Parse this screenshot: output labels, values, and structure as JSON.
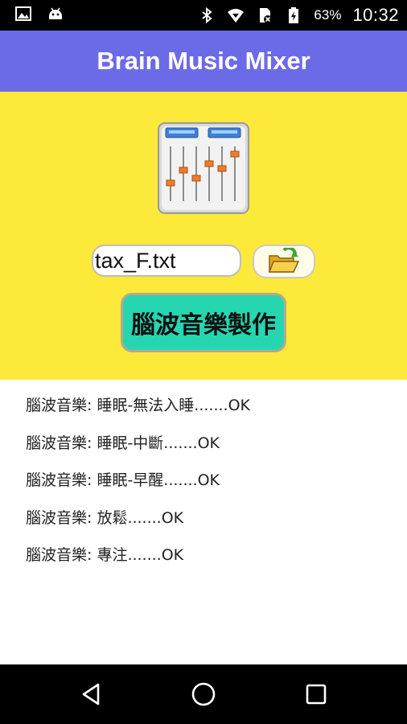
{
  "status_bar": {
    "battery_percent": "63%",
    "time": "10:32",
    "left_icons": [
      "image-notification-icon",
      "android-notification-icon"
    ],
    "right_icons": [
      "bluetooth-icon",
      "wifi-icon",
      "sim-blocked-icon",
      "battery-charging-icon"
    ]
  },
  "app": {
    "title": "Brain Music Mixer"
  },
  "controls": {
    "file_name": "tax_F.txt",
    "make_button_label": "腦波音樂製作"
  },
  "results": [
    "腦波音樂: 睡眠-無法入睡.......OK",
    "腦波音樂: 睡眠-中斷.......OK",
    "腦波音樂: 睡眠-早醒.......OK",
    "腦波音樂: 放鬆.......OK",
    "腦波音樂: 專注.......OK"
  ],
  "colors": {
    "title_bar": "#6b6be8",
    "panel": "#fde93a",
    "make_button": "#26d6b0"
  }
}
